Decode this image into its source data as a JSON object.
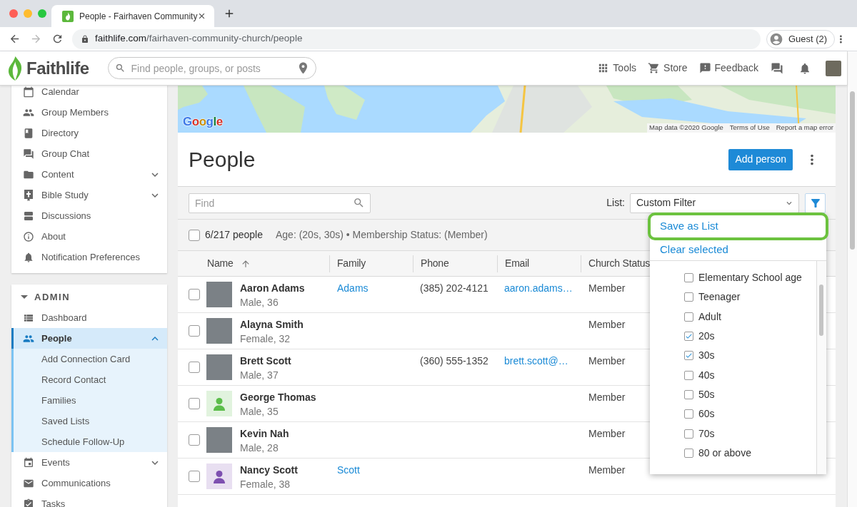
{
  "browser": {
    "tab": {
      "title": "People - Fairhaven Community"
    },
    "forward": {
      "disabled": true
    },
    "address": {
      "host": "faithlife.com",
      "path": "/fairhaven-community-church/people"
    },
    "profile": {
      "label": "Guest (2)"
    }
  },
  "header": {
    "logo": "Faithlife",
    "search": {
      "placeholder": "Find people, groups, or posts"
    },
    "links": [
      {
        "label": "Tools"
      },
      {
        "label": "Store"
      },
      {
        "label": "Feedback"
      }
    ]
  },
  "sidebar": {
    "items": [
      {
        "label": "Calendar",
        "selected": false
      },
      {
        "label": "Group Members",
        "selected": false
      },
      {
        "label": "Directory",
        "selected": false
      },
      {
        "label": "Group Chat",
        "selected": false
      },
      {
        "label": "Content",
        "selected": false,
        "expanded": false
      },
      {
        "label": "Bible Study",
        "selected": false,
        "expanded": false
      },
      {
        "label": "Discussions",
        "selected": false
      },
      {
        "label": "About",
        "selected": false
      },
      {
        "label": "Notification Preferences",
        "selected": false
      }
    ],
    "admin": {
      "title": "ADMIN",
      "expanded": true,
      "items": [
        {
          "label": "Dashboard",
          "selected": false
        },
        {
          "label": "People",
          "selected": true,
          "expanded": true,
          "children": [
            {
              "label": "Add Connection Card",
              "selected": false
            },
            {
              "label": "Record Contact",
              "selected": false
            },
            {
              "label": "Families",
              "selected": false
            },
            {
              "label": "Saved Lists",
              "selected": false
            },
            {
              "label": "Schedule Follow-Up",
              "selected": false
            }
          ]
        },
        {
          "label": "Events",
          "selected": false,
          "expanded": false
        },
        {
          "label": "Communications",
          "selected": false
        },
        {
          "label": "Tasks",
          "selected": false
        }
      ]
    }
  },
  "map": {
    "logo": "Google",
    "data": "Map data ©2020 Google",
    "links": [
      "Terms of Use",
      "Report a map error"
    ]
  },
  "page": {
    "title": "People",
    "add_button": "Add person"
  },
  "toolbar": {
    "find": {
      "placeholder": "Find"
    },
    "list_label": "List:",
    "list_value": "Custom Filter",
    "filter_button": {
      "active": true
    }
  },
  "summary": {
    "checked": false,
    "count": "6/217 people",
    "filters": "Age: (20s, 30s) • Membership Status: (Member)"
  },
  "table": {
    "columns": [
      {
        "label": "Name",
        "sorted": true
      },
      {
        "label": "Family",
        "sorted": false
      },
      {
        "label": "Phone",
        "sorted": false
      },
      {
        "label": "Email",
        "sorted": false
      },
      {
        "label": "Church Status",
        "sorted": false
      }
    ],
    "rows": [
      {
        "checked": false,
        "avatar": {
          "kind": "photo"
        },
        "name": "Aaron Adams",
        "details": "Male, 36",
        "family": "Adams",
        "phone": "(385) 202-4121",
        "email": "aaron.adams…",
        "status": "Member"
      },
      {
        "checked": false,
        "avatar": {
          "kind": "photo"
        },
        "name": "Alayna Smith",
        "details": "Female, 32",
        "status": "Member"
      },
      {
        "checked": false,
        "avatar": {
          "kind": "photo"
        },
        "name": "Brett Scott",
        "details": "Male, 37",
        "phone": "(360) 555-1352",
        "email": "brett.scott@…",
        "status": "Member"
      },
      {
        "checked": false,
        "avatar": {
          "kind": "silhouette",
          "color": "#5bbd4a"
        },
        "name": "George Thomas",
        "details": "Male, 35",
        "status": "Member"
      },
      {
        "checked": false,
        "avatar": {
          "kind": "photo"
        },
        "name": "Kevin Nah",
        "details": "Male, 28",
        "status": "Member"
      },
      {
        "checked": false,
        "avatar": {
          "kind": "silhouette",
          "color": "#7d4fb0"
        },
        "name": "Nancy Scott",
        "details": "Female, 38",
        "family": "Scott",
        "status": "Member"
      }
    ]
  },
  "filter_menu": {
    "actions": [
      {
        "label": "Save as List",
        "highlighted": true
      },
      {
        "label": "Clear selected",
        "highlighted": false
      }
    ],
    "options": [
      {
        "label": "Elementary School age",
        "checked": false
      },
      {
        "label": "Teenager",
        "checked": false
      },
      {
        "label": "Adult",
        "checked": false
      },
      {
        "label": "20s",
        "checked": true
      },
      {
        "label": "30s",
        "checked": true
      },
      {
        "label": "40s",
        "checked": false
      },
      {
        "label": "50s",
        "checked": false
      },
      {
        "label": "60s",
        "checked": false
      },
      {
        "label": "70s",
        "checked": false
      },
      {
        "label": "80 or above",
        "checked": false
      }
    ]
  }
}
